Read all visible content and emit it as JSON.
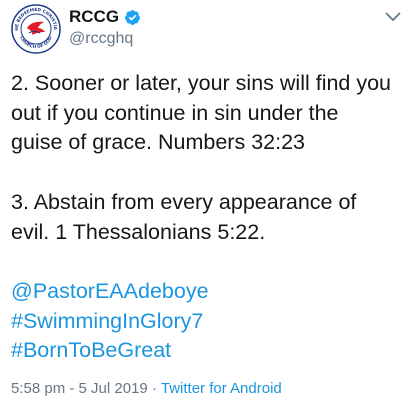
{
  "account": {
    "display_name": "RCCG",
    "handle": "@rccghq",
    "verified": true,
    "avatar": {
      "ring_text_top": "THE REDEEMED CHRISTIAN",
      "ring_text_bottom": "CHURCH OF GOD",
      "ring_color": "#1e3a8a",
      "dove_color": "#e11d2a"
    }
  },
  "tweet": {
    "paragraph_1": [
      "2. Sooner or later, your sins will find you",
      "out if you continue in sin under the",
      "guise of grace. Numbers 32:23"
    ],
    "paragraph_2": [
      "3. Abstain from every appearance of",
      "evil. 1 Thessalonians 5:22."
    ],
    "links": [
      "@PastorEAAdeboye",
      "#SwimmingInGlory7",
      "#BornToBeGreat"
    ]
  },
  "meta": {
    "time": "5:58 pm",
    "separator": "·",
    "date": "5 Jul 2019",
    "source": "Twitter for Android"
  },
  "colors": {
    "text": "#14171a",
    "muted": "#657786",
    "link": "#1b95e0",
    "verified_badge": "#1da1f2"
  },
  "icons": {
    "verified": "verified-badge-icon",
    "menu": "chevron-down-icon"
  }
}
